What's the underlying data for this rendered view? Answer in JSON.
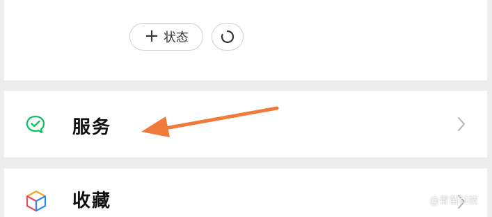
{
  "top_section": {
    "status_button_label": "状态",
    "status_button_icon": "plus-icon",
    "refresh_button_icon": "refresh-icon"
  },
  "menu_items": [
    {
      "label": "服务",
      "icon": "service-check-bubble-icon",
      "icon_color": "#07c160"
    },
    {
      "label": "收藏",
      "icon": "favorites-cube-icon"
    }
  ],
  "annotation": {
    "arrow_color": "#f07a3a"
  },
  "watermark": "@青苗科技"
}
